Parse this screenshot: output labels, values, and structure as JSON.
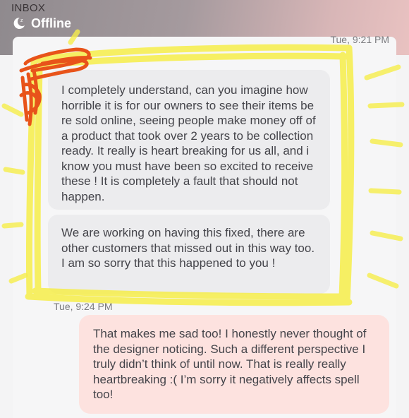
{
  "header": {
    "section_label": "INBOX",
    "status_icon": "moon-z-icon",
    "status_text": "Offline"
  },
  "messages": [
    {
      "timestamp": "Tue, 9:21 PM"
    },
    {
      "direction": "incoming",
      "text": "I completely understand, can you imagine how horrible it is for our owners to see their items be re sold online, seeing people make money off of a product that took over 2 years to be collection ready. It really is heart breaking for us all, and i know you must have been so excited to receive these ! It is completely a fault that should not happen."
    },
    {
      "direction": "incoming",
      "text": "We are working on having this fixed, there are other customers that missed out in this way too. I am so sorry that this happened to you !"
    },
    {
      "timestamp": "Tue, 9:24 PM"
    },
    {
      "direction": "outgoing",
      "text": "That makes me sad too! I honestly never thought of the designer noticing. Such a different perspective I truly didn’t think of until now. That is really really heartbreaking :( I’m sorry it negatively affects spell too!"
    }
  ],
  "colors": {
    "incoming_bubble": "#ececee",
    "outgoing_bubble": "#fde2df",
    "highlight_yellow": "#f6ee4a",
    "scribble_orange": "#e8531a"
  }
}
